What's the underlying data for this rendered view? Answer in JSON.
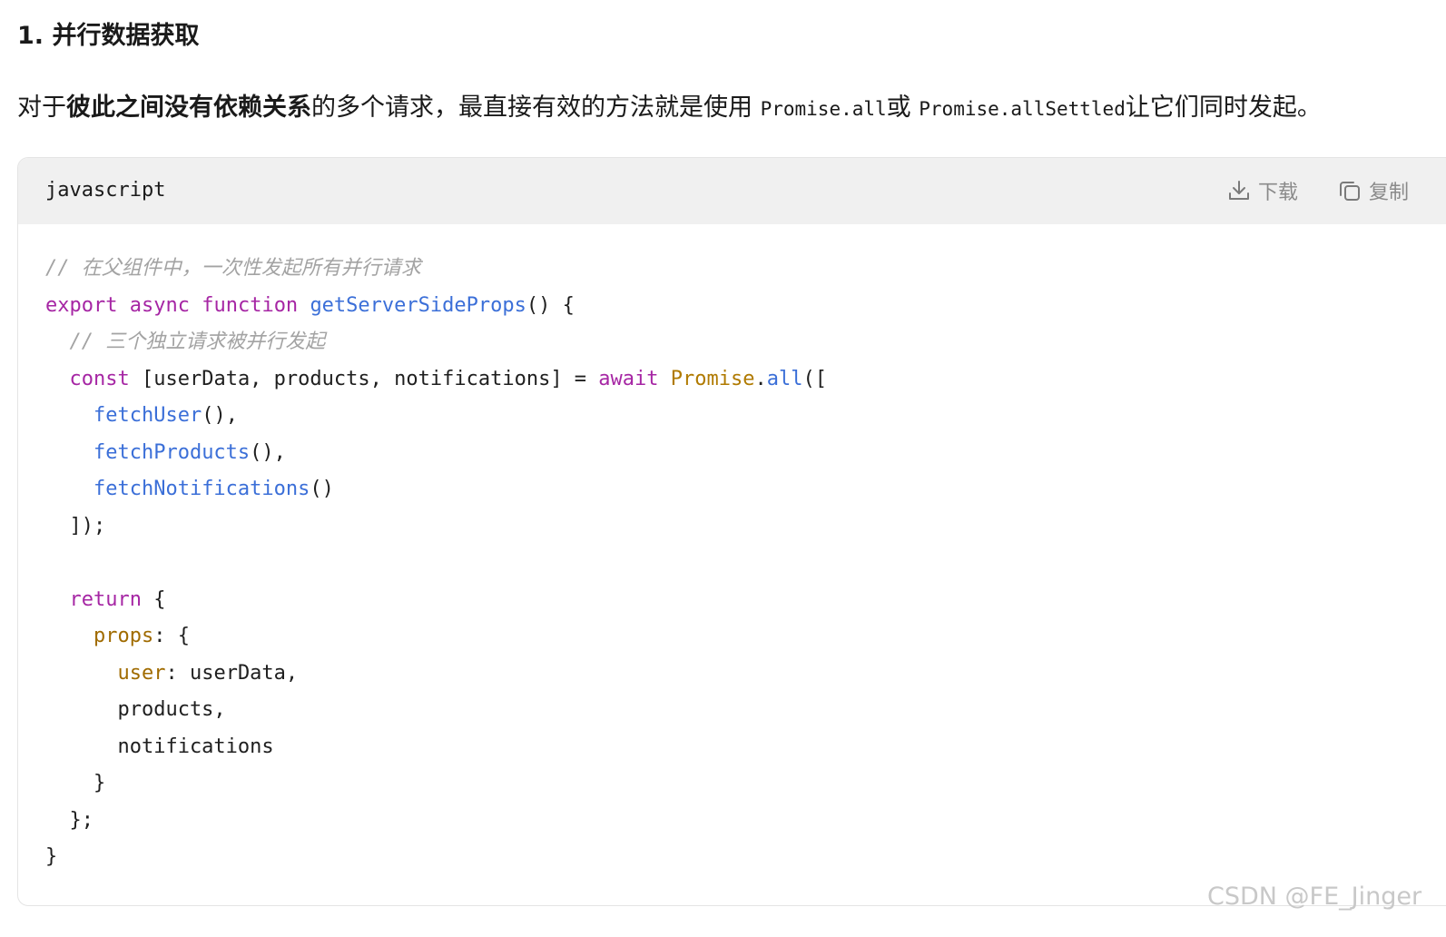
{
  "heading": {
    "number": "1.",
    "title": "并行数据获取"
  },
  "paragraph": {
    "part1": "对于",
    "bold": "彼此之间没有依赖关系",
    "part2": "的多个请求，最直接有效的方法就是使用",
    "code1": "Promise.all",
    "part3": "或",
    "code2": "Promise.allSettled",
    "part4": "让它们同时发起。"
  },
  "code_block": {
    "language": "javascript",
    "download_label": "下载",
    "copy_label": "复制",
    "icons": [
      "download-icon",
      "copy-icon"
    ],
    "lines": [
      [
        {
          "t": "comment",
          "v": "// 在父组件中，一次性发起所有并行请求"
        }
      ],
      [
        {
          "t": "keyword",
          "v": "export"
        },
        {
          "t": "plain",
          "v": " "
        },
        {
          "t": "keyword",
          "v": "async"
        },
        {
          "t": "plain",
          "v": " "
        },
        {
          "t": "keyword",
          "v": "function"
        },
        {
          "t": "plain",
          "v": " "
        },
        {
          "t": "func",
          "v": "getServerSideProps"
        },
        {
          "t": "plain",
          "v": "() {"
        }
      ],
      [
        {
          "t": "plain",
          "v": "  "
        },
        {
          "t": "comment",
          "v": "// 三个独立请求被并行发起"
        }
      ],
      [
        {
          "t": "plain",
          "v": "  "
        },
        {
          "t": "keyword",
          "v": "const"
        },
        {
          "t": "plain",
          "v": " [userData, products, notifications] = "
        },
        {
          "t": "keyword",
          "v": "await"
        },
        {
          "t": "plain",
          "v": " "
        },
        {
          "t": "class",
          "v": "Promise"
        },
        {
          "t": "plain",
          "v": "."
        },
        {
          "t": "func",
          "v": "all"
        },
        {
          "t": "plain",
          "v": "(["
        }
      ],
      [
        {
          "t": "plain",
          "v": "    "
        },
        {
          "t": "func",
          "v": "fetchUser"
        },
        {
          "t": "plain",
          "v": "(),"
        }
      ],
      [
        {
          "t": "plain",
          "v": "    "
        },
        {
          "t": "func",
          "v": "fetchProducts"
        },
        {
          "t": "plain",
          "v": "(),"
        }
      ],
      [
        {
          "t": "plain",
          "v": "    "
        },
        {
          "t": "func",
          "v": "fetchNotifications"
        },
        {
          "t": "plain",
          "v": "()"
        }
      ],
      [
        {
          "t": "plain",
          "v": "  ]);"
        }
      ],
      [
        {
          "t": "plain",
          "v": ""
        }
      ],
      [
        {
          "t": "plain",
          "v": "  "
        },
        {
          "t": "keyword",
          "v": "return"
        },
        {
          "t": "plain",
          "v": " {"
        }
      ],
      [
        {
          "t": "plain",
          "v": "    "
        },
        {
          "t": "prop",
          "v": "props"
        },
        {
          "t": "plain",
          "v": ": {"
        }
      ],
      [
        {
          "t": "plain",
          "v": "      "
        },
        {
          "t": "prop",
          "v": "user"
        },
        {
          "t": "plain",
          "v": ": userData,"
        }
      ],
      [
        {
          "t": "plain",
          "v": "      products,"
        }
      ],
      [
        {
          "t": "plain",
          "v": "      notifications"
        }
      ],
      [
        {
          "t": "plain",
          "v": "    }"
        }
      ],
      [
        {
          "t": "plain",
          "v": "  };"
        }
      ],
      [
        {
          "t": "plain",
          "v": "}"
        }
      ]
    ]
  },
  "watermark": "CSDN @FE_Jinger",
  "colors": {
    "keyword": "#a626a4",
    "function": "#3b6fd8",
    "class": "#b07a00",
    "property": "#a06b00",
    "comment": "#a3a3a3",
    "header_bg": "#f0f0f0"
  }
}
